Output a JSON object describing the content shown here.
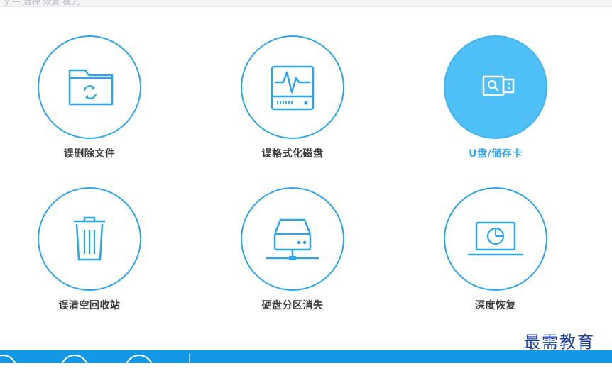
{
  "topbar": {
    "ghost_text": "y — 选择 恢复 模式"
  },
  "tiles": [
    {
      "label": "误删除文件",
      "icon": "folder-recycle-icon",
      "active": false
    },
    {
      "label": "误格式化磁盘",
      "icon": "disk-pulse-icon",
      "active": false
    },
    {
      "label": "U盘/储存卡",
      "icon": "usb-drive-icon",
      "active": true
    },
    {
      "label": "误清空回收站",
      "icon": "trash-bin-icon",
      "active": false
    },
    {
      "label": "硬盘分区消失",
      "icon": "network-drive-icon",
      "active": false
    },
    {
      "label": "深度恢复",
      "icon": "laptop-scan-icon",
      "active": false
    }
  ],
  "watermark": "最需教育",
  "colors": {
    "accent": "#2ea4ea",
    "active_fill": "#4fbff7",
    "active_label": "#35a9ef",
    "bottom_bar": "#1497e5",
    "watermark": "#1b3fa8"
  }
}
